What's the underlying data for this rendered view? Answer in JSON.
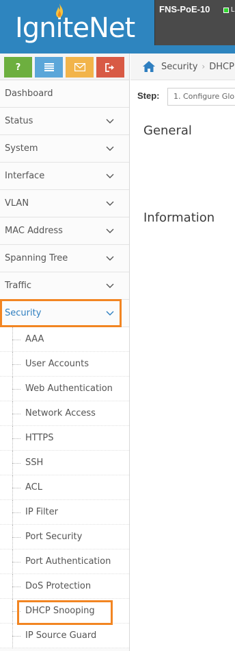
{
  "header": {
    "logo_text": "IgniteNet",
    "device_name": "FNS-PoE-10",
    "status_letter": "L",
    "colors": {
      "header_bg": "#2e85bf",
      "device_bg": "#4a4a4a",
      "status_green": "#2fd62f"
    }
  },
  "shortcuts": [
    {
      "icon": "help-icon",
      "label": "?",
      "color": "#6daf3f"
    },
    {
      "icon": "list-icon",
      "color": "#5ba6d9"
    },
    {
      "icon": "mail-icon",
      "color": "#f2b44a"
    },
    {
      "icon": "logout-icon",
      "color": "#d85a45"
    }
  ],
  "sidebar": {
    "items": [
      {
        "label": "Dashboard",
        "has_chevron": false
      },
      {
        "label": "Status",
        "has_chevron": true
      },
      {
        "label": "System",
        "has_chevron": true
      },
      {
        "label": "Interface",
        "has_chevron": true
      },
      {
        "label": "VLAN",
        "has_chevron": true
      },
      {
        "label": "MAC Address",
        "has_chevron": true
      },
      {
        "label": "Spanning Tree",
        "has_chevron": true
      },
      {
        "label": "Traffic",
        "has_chevron": true
      },
      {
        "label": "Security",
        "has_chevron": true,
        "active": true
      }
    ],
    "security_submenu": [
      "AAA",
      "User Accounts",
      "Web Authentication",
      "Network Access",
      "HTTPS",
      "SSH",
      "ACL",
      "IP Filter",
      "Port Security",
      "Port Authentication",
      "DoS Protection",
      "DHCP Snooping",
      "IP Source Guard"
    ],
    "active_color": "#2f7fc0",
    "highlight_color": "#f28522"
  },
  "breadcrumb": {
    "items": [
      "Security",
      "DHCP"
    ]
  },
  "step": {
    "label": "Step:",
    "selected_value": "1. Configure Glo"
  },
  "sections": {
    "general": "General",
    "information": "Information"
  }
}
